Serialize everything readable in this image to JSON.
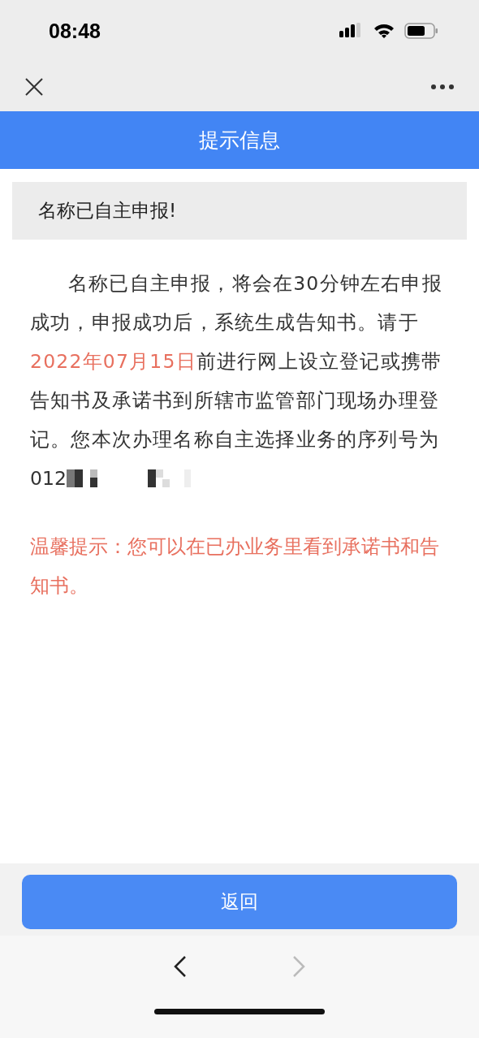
{
  "status_bar": {
    "time": "08:48"
  },
  "header": {
    "title": "提示信息"
  },
  "banner": {
    "text": "名称已自主申报!"
  },
  "notice": {
    "segments": [
      {
        "text": "名称已自主申报，将会在30分钟左右申报成功，申报成功后，系统生成告知书。请于",
        "highlight": false
      },
      {
        "text": "2022年07月15日",
        "highlight": true
      },
      {
        "text": "前进行网上设立登记或携带告知书及承诺书到所辖市监管部门现场办理登记。您本次办理名称自主选择业务的序列号为",
        "highlight": false
      }
    ],
    "serial_visible": "012"
  },
  "tip": {
    "text": "温馨提示：您可以在已办业务里看到承诺书和告知书。"
  },
  "return_button": {
    "label": "返回"
  },
  "browser_nav": {
    "back_disabled": false,
    "forward_disabled": true
  }
}
